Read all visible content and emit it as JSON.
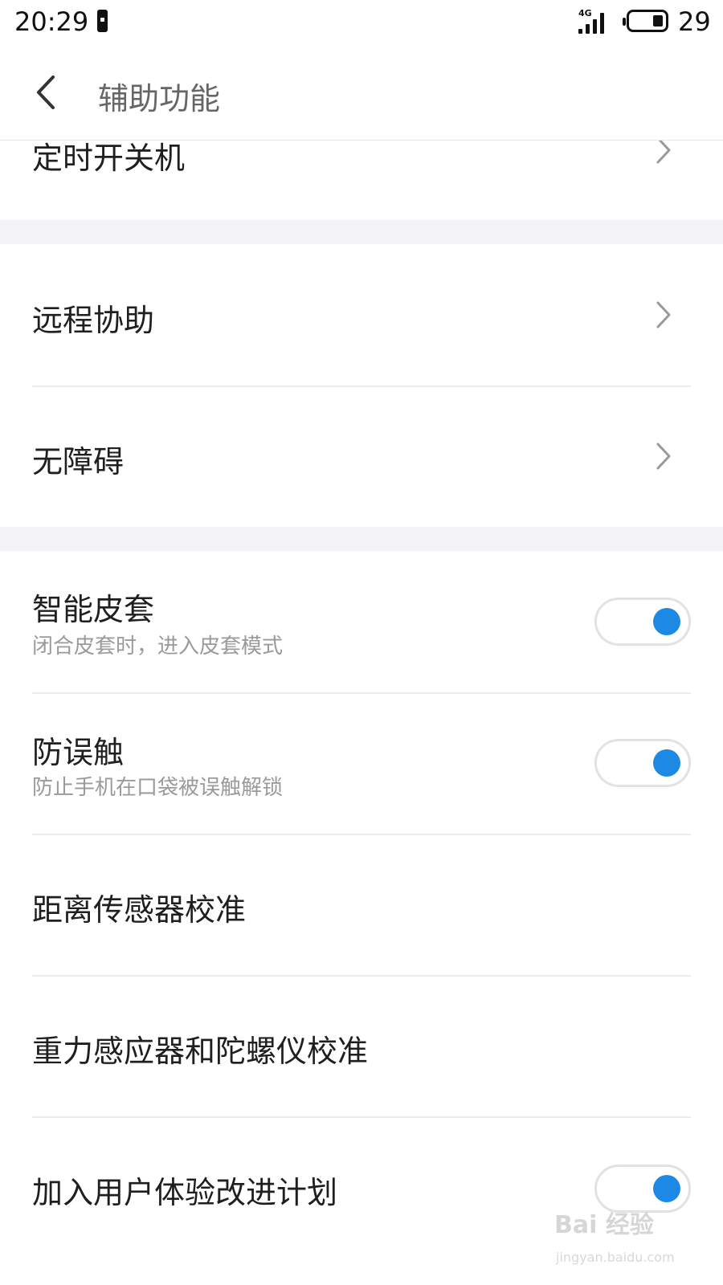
{
  "status_bar": {
    "time": "20:29",
    "network": "4G",
    "battery_percent": "29"
  },
  "header": {
    "title": "辅助功能"
  },
  "rows": {
    "scheduled_power": {
      "title": "定时开关机"
    },
    "remote_assist": {
      "title": "远程协助"
    },
    "accessibility": {
      "title": "无障碍"
    },
    "smart_cover": {
      "title": "智能皮套",
      "subtitle": "闭合皮套时，进入皮套模式",
      "enabled": true
    },
    "anti_mistouch": {
      "title": "防误触",
      "subtitle": "防止手机在口袋被误触解锁",
      "enabled": true
    },
    "proximity_calibration": {
      "title": "距离传感器校准"
    },
    "gravity_gyro_calibration": {
      "title": "重力感应器和陀螺仪校准"
    },
    "user_experience_program": {
      "title": "加入用户体验改进计划",
      "enabled": true
    }
  },
  "watermark": {
    "text": "Bai 经验",
    "url": "jingyan.baidu.com"
  },
  "colors": {
    "toggle_on": "#1e88e5",
    "section_gap": "#f4f4f6",
    "subtitle": "#9a9a9a"
  }
}
